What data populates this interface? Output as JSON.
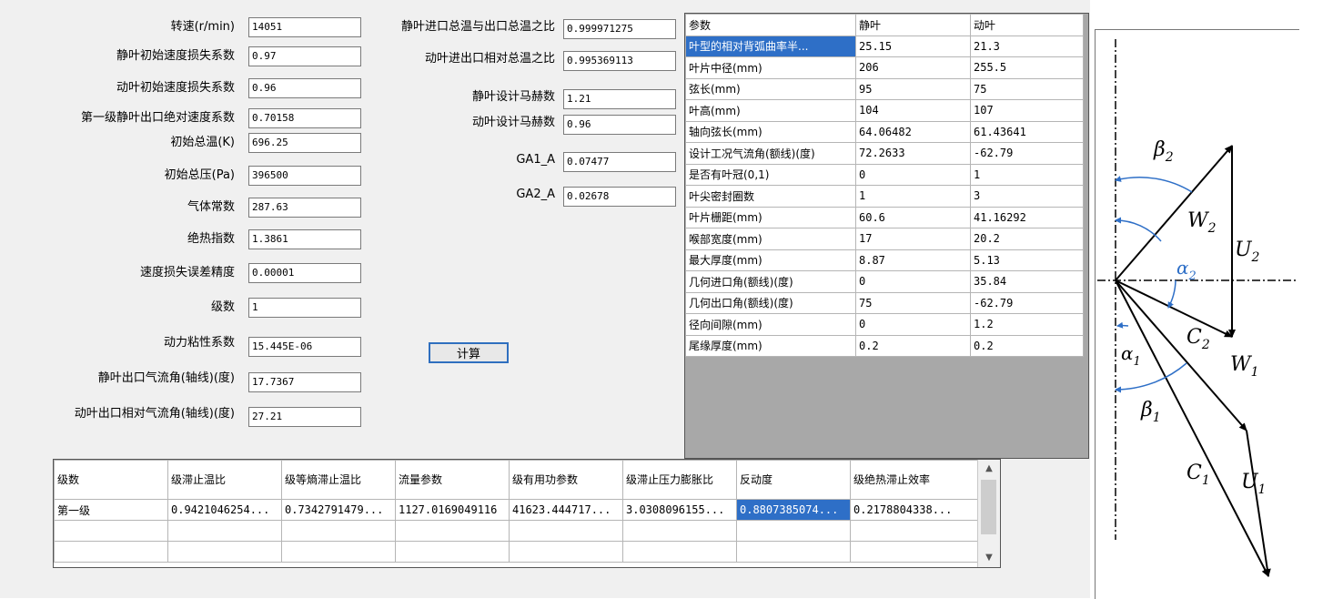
{
  "inputs_left": [
    {
      "label": "转速(r/min)",
      "value": "14051"
    },
    {
      "label": "静叶初始速度损失系数",
      "value": "0.97"
    },
    {
      "label": "动叶初始速度损失系数",
      "value": "0.96"
    },
    {
      "label": "第一级静叶出口绝对速度系数",
      "value": "0.70158"
    },
    {
      "label": "初始总温(K)",
      "value": "696.25"
    },
    {
      "label": "初始总压(Pa)",
      "value": "396500"
    },
    {
      "label": "气体常数",
      "value": "287.63"
    },
    {
      "label": "绝热指数",
      "value": "1.3861"
    },
    {
      "label": "速度损失误差精度",
      "value": "0.00001"
    },
    {
      "label": "级数",
      "value": "1"
    },
    {
      "label": "动力粘性系数",
      "value": "15.445E-06"
    },
    {
      "label": "静叶出口气流角(轴线)(度)",
      "value": "17.7367"
    },
    {
      "label": "动叶出口相对气流角(轴线)(度)",
      "value": "27.21"
    }
  ],
  "inputs_mid": [
    {
      "label": "静叶进口总温与出口总温之比",
      "value": "0.999971275"
    },
    {
      "label": "动叶进出口相对总温之比",
      "value": "0.995369113"
    },
    {
      "label": "静叶设计马赫数",
      "value": "1.21"
    },
    {
      "label": "动叶设计马赫数",
      "value": "0.96"
    },
    {
      "label": "GA1_A",
      "value": "0.07477"
    },
    {
      "label": "GA2_A",
      "value": "0.02678"
    }
  ],
  "calc_button": "计算",
  "param_table": {
    "headers": [
      "参数",
      "静叶",
      "动叶"
    ],
    "rows": [
      [
        "叶型的相对背弧曲率半...",
        "25.15",
        "21.3"
      ],
      [
        "叶片中径(mm)",
        "206",
        "255.5"
      ],
      [
        "弦长(mm)",
        "95",
        "75"
      ],
      [
        "叶高(mm)",
        "104",
        "107"
      ],
      [
        "轴向弦长(mm)",
        "64.06482",
        "61.43641"
      ],
      [
        "设计工况气流角(额线)(度)",
        "72.2633",
        "-62.79"
      ],
      [
        "是否有叶冠(0,1)",
        "0",
        "1"
      ],
      [
        "叶尖密封圈数",
        "1",
        "3"
      ],
      [
        "叶片栅距(mm)",
        "60.6",
        "41.16292"
      ],
      [
        "喉部宽度(mm)",
        "17",
        "20.2"
      ],
      [
        "最大厚度(mm)",
        "8.87",
        "5.13"
      ],
      [
        "几何进口角(额线)(度)",
        "0",
        "35.84"
      ],
      [
        "几何出口角(额线)(度)",
        "75",
        "-62.79"
      ],
      [
        "径向间隙(mm)",
        "0",
        "1.2"
      ],
      [
        "尾缘厚度(mm)",
        "0.2",
        "0.2"
      ]
    ]
  },
  "result_table": {
    "headers": [
      "级数",
      "级滞止温比",
      "级等熵滞止温比",
      "流量参数",
      "级有用功参数",
      "级滞止压力膨胀比",
      "反动度",
      "级绝热滞止效率"
    ],
    "rows": [
      [
        "第一级",
        "0.9421046254...",
        "0.7342791479...",
        "1127.0169049116",
        "41623.444717...",
        "3.0308096155...",
        "0.8807385074...",
        "0.2178804338..."
      ]
    ]
  },
  "diagram_labels": {
    "beta2": "β",
    "beta2_sub": "2",
    "w2": "W",
    "w2_sub": "2",
    "u2": "U",
    "u2_sub": "2",
    "alpha2": "α",
    "alpha2_sub": "2",
    "alpha1": "α",
    "alpha1_sub": "1",
    "c2": "C",
    "c2_sub": "2",
    "w1": "W",
    "w1_sub": "1",
    "beta1": "β",
    "beta1_sub": "1",
    "c1": "C",
    "c1_sub": "1",
    "u1": "U",
    "u1_sub": "1"
  },
  "colors": {
    "selection": "#2e6fc7",
    "arc": "#2e6fc7",
    "button_border": "#2f6fbf"
  }
}
